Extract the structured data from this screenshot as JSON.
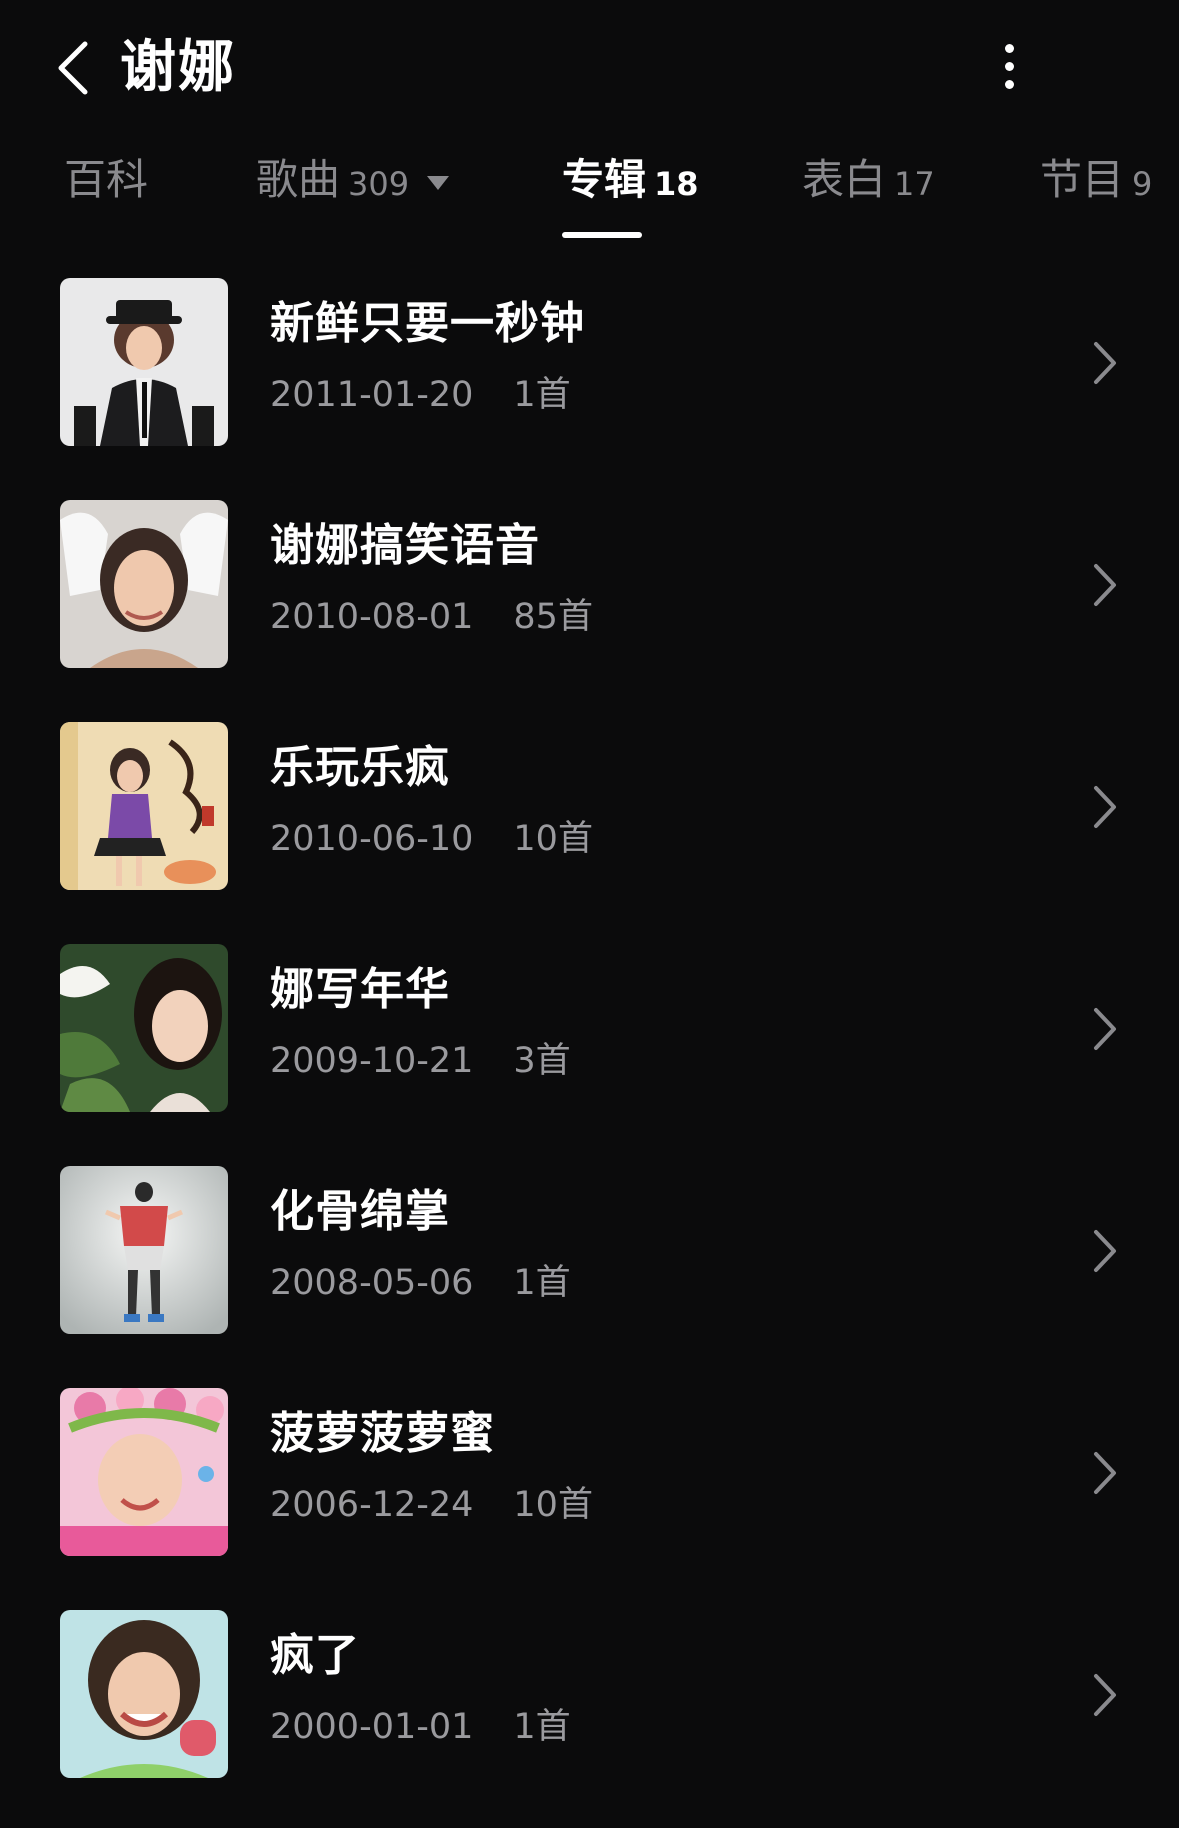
{
  "header": {
    "title": "谢娜",
    "back_icon": "chevron-left-icon",
    "more_icon": "vertical-ellipsis-icon"
  },
  "tabs": [
    {
      "label": "百科",
      "count": ""
    },
    {
      "label": "歌曲",
      "count": "309"
    },
    {
      "label": "专辑",
      "count": "18"
    },
    {
      "label": "表白",
      "count": "17"
    },
    {
      "label": "节目",
      "count": "9"
    }
  ],
  "active_tab": "专辑",
  "albums": [
    {
      "title": "新鲜只要一秒钟",
      "date": "2011-01-20",
      "count": "1首"
    },
    {
      "title": "谢娜搞笑语音",
      "date": "2010-08-01",
      "count": "85首"
    },
    {
      "title": "乐玩乐疯",
      "date": "2010-06-10",
      "count": "10首"
    },
    {
      "title": "娜写年华",
      "date": "2009-10-21",
      "count": "3首"
    },
    {
      "title": "化骨绵掌",
      "date": "2008-05-06",
      "count": "1首"
    },
    {
      "title": "菠萝菠萝蜜",
      "date": "2006-12-24",
      "count": "10首"
    },
    {
      "title": "疯了",
      "date": "2000-01-01",
      "count": "1首"
    }
  ],
  "colors": {
    "background": "#0b0b0c",
    "text_primary": "#ffffff",
    "text_secondary": "#9a9a9e",
    "tab_inactive": "#8a8a8e"
  }
}
